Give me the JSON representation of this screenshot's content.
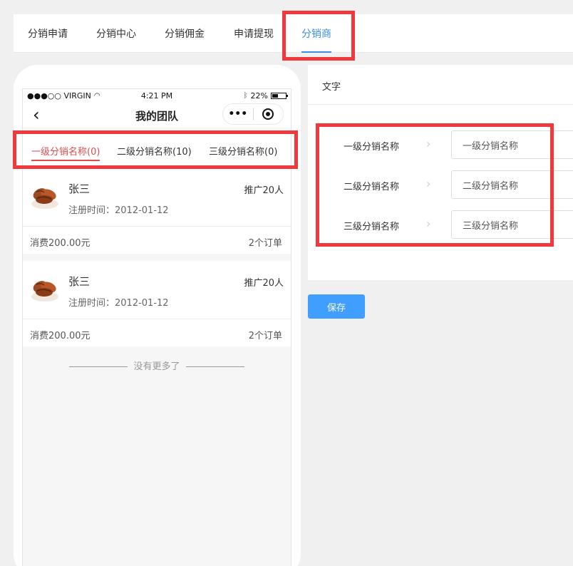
{
  "top_tabs": [
    {
      "label": "分销申请"
    },
    {
      "label": "分销中心"
    },
    {
      "label": "分销佣金"
    },
    {
      "label": "申请提现"
    },
    {
      "label": "分销商",
      "active": true
    }
  ],
  "phone": {
    "status_bar": {
      "carrier": "●●●○○ VIRGIN",
      "time": "4:21 PM",
      "battery": "22%"
    },
    "nav_title": "我的团队",
    "tabs": [
      {
        "label": "一级分销名称(0)",
        "active": true
      },
      {
        "label": "二级分销名称(10)"
      },
      {
        "label": "三级分销名称(0)"
      }
    ],
    "members": [
      {
        "name": "张三",
        "promo": "推广20人",
        "reg": "注册时间：2012-01-12",
        "spend": "消费200.00元",
        "orders": "2个订单"
      },
      {
        "name": "张三",
        "promo": "推广20人",
        "reg": "注册时间：2012-01-12",
        "spend": "消费200.00元",
        "orders": "2个订单"
      }
    ],
    "no_more": "没有更多了"
  },
  "settings": {
    "header": "文字",
    "rows": [
      {
        "label": "一级分销名称",
        "value": "一级分销名称"
      },
      {
        "label": "二级分销名称",
        "value": "二级分销名称"
      },
      {
        "label": "三级分销名称",
        "value": "三级分销名称"
      }
    ]
  },
  "save_label": "保存",
  "colors": {
    "accent": "#409eff",
    "active_tab": "#3a8ee6",
    "phone_active": "#e04c4c",
    "highlight": "#f0393c"
  }
}
